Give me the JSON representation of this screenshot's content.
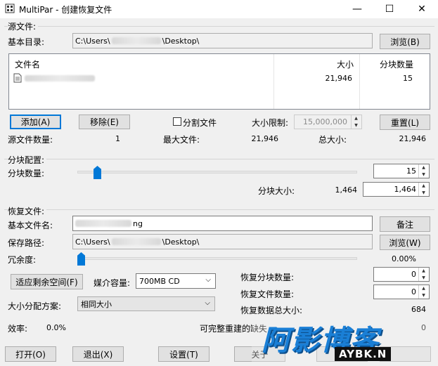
{
  "window": {
    "title": "MultiPar - 创建恢复文件",
    "minimize": "—",
    "maximize": "☐",
    "close": "✕"
  },
  "source": {
    "section_label": "源文件:",
    "base_dir_label": "基本目录:",
    "base_dir_value_prefix": "C:\\Users\\",
    "base_dir_value_suffix": "\\Desktop\\",
    "browse_button": "浏览(B)",
    "table_headers": {
      "name": "文件名",
      "size": "大小",
      "blocks": "分块数量"
    },
    "files": [
      {
        "size": "21,946",
        "blocks": "15"
      }
    ],
    "add_button": "添加(A)",
    "remove_button": "移除(E)",
    "split_label": "分割文件",
    "size_limit_label": "大小限制:",
    "size_limit_value": "15,000,000",
    "reset_button": "重置(L)",
    "file_count_label": "源文件数量:",
    "file_count_value": "1",
    "max_file_label": "最大文件:",
    "max_file_value": "21,946",
    "total_size_label": "总大小:",
    "total_size_value": "21,946"
  },
  "block": {
    "section_label": "分块配置:",
    "count_label": "分块数量:",
    "count_value": "15",
    "count_slider_fraction": 0.06,
    "size_label": "分块大小:",
    "size_text": "1,464",
    "size_value": "1,464"
  },
  "recovery": {
    "section_label": "恢复文件:",
    "base_name_label": "基本文件名:",
    "base_name_suffix": "ng",
    "notes_button": "备注",
    "save_path_label": "保存路径:",
    "save_path_prefix": "C:\\Users\\",
    "save_path_suffix": "\\Desktop\\",
    "browse_button": "浏览(W)",
    "redundancy_label": "冗余度:",
    "redundancy_value": "0.00%",
    "redundancy_slider_fraction": 0.0,
    "fit_button": "适应剩余空间(F)",
    "media_label": "媒介容量:",
    "media_value": "700MB CD",
    "alloc_label": "大小分配方案:",
    "alloc_value": "相同大小",
    "recovery_blocks_label": "恢复分块数量:",
    "recovery_blocks_value": "0",
    "recovery_files_label": "恢复文件数量:",
    "recovery_files_value": "0",
    "recovery_total_label": "恢复数据总大小:",
    "recovery_total_value": "684",
    "efficiency_label": "效率:",
    "efficiency_value": "0.0%",
    "rebuild_label": "可完整重建的缺失",
    "rebuild_value": "0"
  },
  "footer": {
    "open_button": "打开(O)",
    "exit_button": "退出(X)",
    "settings_button": "设置(T)",
    "about_button": "关于"
  },
  "watermark": {
    "main": "阿影博客",
    "sub": "AYBK.N"
  }
}
